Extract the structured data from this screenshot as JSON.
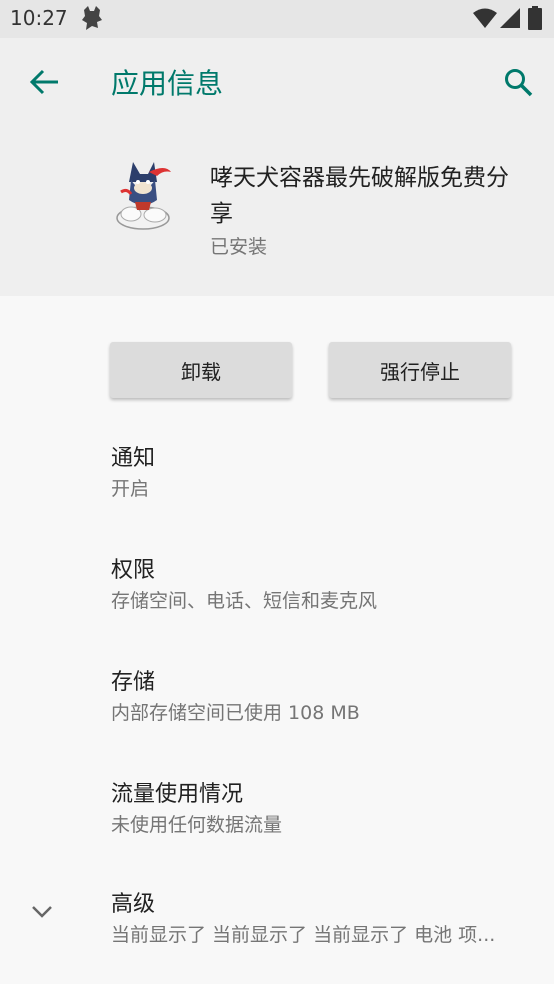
{
  "status_bar": {
    "time": "10:27",
    "icons": [
      "app-notification-icon",
      "wifi-icon",
      "signal-icon",
      "battery-icon"
    ]
  },
  "header": {
    "title": "应用信息",
    "back_icon": "arrow-back-icon",
    "search_icon": "search-icon"
  },
  "app": {
    "name": "哮天犬容器最先破解版免费分享",
    "status": "已安装"
  },
  "buttons": {
    "uninstall": "卸载",
    "force_stop": "强行停止"
  },
  "settings": [
    {
      "title": "通知",
      "summary": "开启"
    },
    {
      "title": "权限",
      "summary": "存储空间、电话、短信和麦克风"
    },
    {
      "title": "存储",
      "summary": "内部存储空间已使用 108 MB"
    },
    {
      "title": "流量使用情况",
      "summary": "未使用任何数据流量"
    },
    {
      "title": "高级",
      "summary": "当前显示了 当前显示了 当前显示了 电池 项..."
    }
  ],
  "colors": {
    "accent": "#00796b",
    "header_bg": "#efefef",
    "status_bar_bg": "#e6e6e6",
    "button_bg": "#dcdcdc"
  }
}
